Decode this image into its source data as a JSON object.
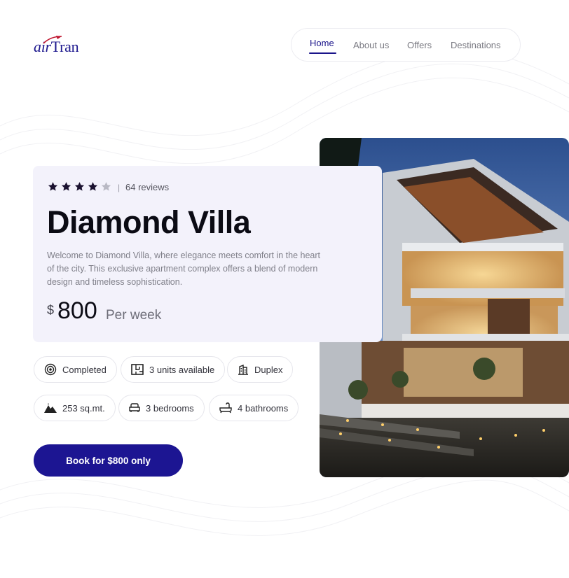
{
  "brand": {
    "logo_prefix": "air",
    "logo_suffix": "Tran",
    "color": "#1f1a8f"
  },
  "nav": {
    "items": [
      {
        "label": "Home",
        "active": true
      },
      {
        "label": "About us",
        "active": false
      },
      {
        "label": "Offers",
        "active": false
      },
      {
        "label": "Destinations",
        "active": false
      }
    ]
  },
  "listing": {
    "rating": 4,
    "rating_max": 5,
    "separator": "|",
    "reviews_label": "64 reviews",
    "title": "Diamond Villa",
    "description": "Welcome to Diamond Villa, where elegance meets comfort in the heart of the city. This exclusive apartment complex offers a blend of modern design and timeless sophistication.",
    "price": {
      "currency": "$",
      "amount": "800",
      "period": "Per week"
    }
  },
  "features": [
    {
      "icon": "target-icon",
      "label": "Completed"
    },
    {
      "icon": "floorplan-icon",
      "label": "3 units available"
    },
    {
      "icon": "building-icon",
      "label": "Duplex"
    },
    {
      "icon": "mountain-icon",
      "label": "253 sq.mt."
    },
    {
      "icon": "sofa-icon",
      "label": "3 bedrooms"
    },
    {
      "icon": "bathtub-icon",
      "label": "4 bathrooms"
    }
  ],
  "cta": {
    "label": "Book for $800 only"
  },
  "colors": {
    "accent": "#1c1592",
    "card_bg": "#f3f2fb",
    "star_filled": "#1b1230",
    "star_empty": "#b9b9c4"
  }
}
